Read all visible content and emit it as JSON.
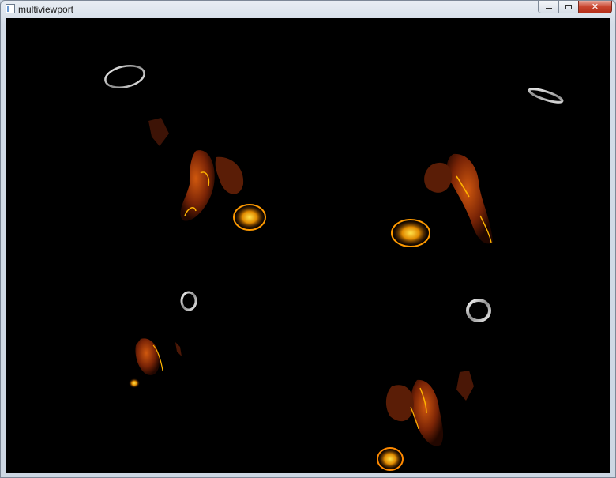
{
  "window": {
    "title": "multiviewport",
    "icon": "application-window-icon"
  },
  "caption_buttons": {
    "minimize": "minimize-icon",
    "maximize": "maximize-icon",
    "close_label": "✕"
  },
  "scene": {
    "background": "#000000",
    "mesh_color": "#b0430a",
    "highlight_color": "#ffb400",
    "ring_color": "#d8d8d8"
  }
}
